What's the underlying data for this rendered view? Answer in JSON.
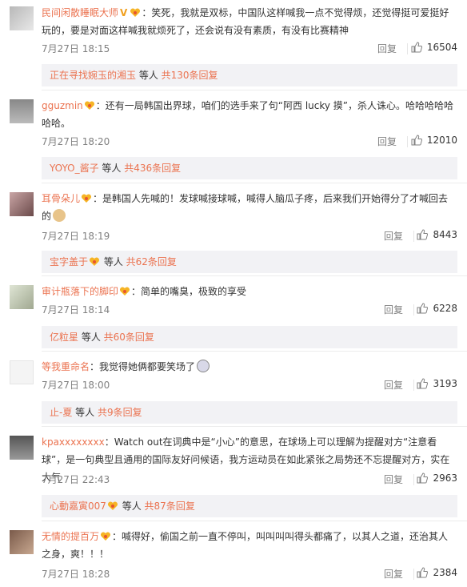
{
  "comments": [
    {
      "name": "民间闲散睡眠大师",
      "text": "：笑死，我就是双标，中国队这样喊我一点不觉得烦，还觉得挺可爱挺好玩的，要是对面这样喊我就烦死了，还会说有没有素质，有没有比赛精神",
      "time": "7月27日 18:15",
      "reply": "回复",
      "likes": "16504",
      "sub_user": "正在寻找婉玉的湘玉",
      "sub_mid": " 等人 ",
      "sub_count": "共130条回复"
    },
    {
      "name": "gguzmin",
      "text": "：还有一局韩国出界球，咱们的选手来了句“阿西 lucky 摸”，杀人诛心。哈哈哈哈哈哈哈。",
      "time": "7月27日 18:20",
      "reply": "回复",
      "likes": "12010",
      "sub_user": "YOYO_酱子",
      "sub_mid": " 等人 ",
      "sub_count": "共436条回复"
    },
    {
      "name": "耳骨朵儿",
      "text": "：是韩国人先喊的！发球喊接球喊，喊得人脑瓜子疼，后来我们开始得分了才喊回去的",
      "time": "7月27日 18:19",
      "reply": "回复",
      "likes": "8443",
      "sub_user": "宝字盖于",
      "sub_mid": " 等人 ",
      "sub_count": "共62条回复"
    },
    {
      "name": "审计瓶落下的脚印",
      "text": "：简单的嘴臭，极致的享受",
      "time": "7月27日 18:14",
      "reply": "回复",
      "likes": "6228",
      "sub_user": "亿粒星",
      "sub_mid": " 等人 ",
      "sub_count": "共60条回复"
    },
    {
      "name": "等我重命名",
      "text": "：我觉得她俩都要笑场了",
      "time": "7月27日 18:00",
      "reply": "回复",
      "likes": "3193",
      "sub_user": "止-夏",
      "sub_mid": " 等人 ",
      "sub_count": "共9条回复"
    },
    {
      "name": "kpaxxxxxxxx",
      "text": "：Watch out在词典中是“小心”的意思，在球场上可以理解为提醒对方“注意看球”，是一句典型且通用的国际友好问候语，我方运动员在如此紧张之局势还不忘提醒对方，实在大气",
      "time": "7月27日 22:43",
      "reply": "回复",
      "likes": "2963",
      "sub_user": "心動嘉寅007",
      "sub_mid": " 等人 ",
      "sub_count": "共87条回复"
    },
    {
      "name": "无情的提百万",
      "text": "：喊得好，偷国之前一直不停叫，叫叫叫叫得头都痛了，以其人之道，还治其人之身，爽！！！",
      "time": "7月27日 18:28",
      "reply": "回复",
      "likes": "2384"
    }
  ],
  "colors": {
    "accent": "#eb7350",
    "text": "#333333",
    "meta": "#808080",
    "subbox": "#f2f2f5"
  }
}
